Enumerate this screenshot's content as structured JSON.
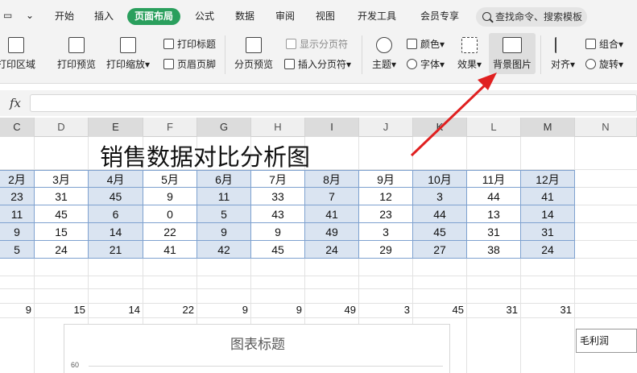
{
  "menu": {
    "tabs": [
      "开始",
      "插入",
      "页面布局",
      "公式",
      "数据",
      "审阅",
      "视图",
      "开发工具",
      "会员专享"
    ],
    "active": "页面布局",
    "search_text": "查找命令、搜索模板"
  },
  "ribbon": {
    "print_area": "打印区域",
    "print_preview": "打印预览",
    "print_scale": "打印缩放",
    "print_titles": "打印标题",
    "header_footer": "页眉页脚",
    "page_break_preview": "分页预览",
    "show_page_break": "显示分页符",
    "insert_page_break": "插入分页符",
    "theme": "主题",
    "color": "颜色",
    "font": "字体",
    "effects": "效果",
    "background_image": "背景图片",
    "align": "对齐",
    "group": "组合",
    "rotate": "旋转"
  },
  "formula_bar": {
    "fx": "fx"
  },
  "columns": [
    "C",
    "D",
    "E",
    "F",
    "G",
    "H",
    "I",
    "J",
    "K",
    "L",
    "M",
    "N"
  ],
  "sheet": {
    "title": "销售数据对比分析图",
    "months": [
      "2月",
      "3月",
      "4月",
      "5月",
      "6月",
      "7月",
      "8月",
      "9月",
      "10月",
      "11月",
      "12月"
    ],
    "rows": [
      [
        "23",
        "31",
        "45",
        "9",
        "11",
        "33",
        "7",
        "12",
        "3",
        "44",
        "41"
      ],
      [
        "11",
        "45",
        "6",
        "0",
        "5",
        "43",
        "41",
        "23",
        "44",
        "13",
        "14"
      ],
      [
        "9",
        "15",
        "14",
        "22",
        "9",
        "9",
        "49",
        "3",
        "45",
        "31",
        "31"
      ],
      [
        "5",
        "24",
        "21",
        "41",
        "42",
        "45",
        "24",
        "29",
        "27",
        "38",
        "24"
      ]
    ],
    "extra_row": [
      "9",
      "15",
      "14",
      "22",
      "9",
      "9",
      "49",
      "3",
      "45",
      "31",
      "31"
    ],
    "legend_label": "毛利润"
  },
  "chart": {
    "title": "图表标题",
    "ytick": "60"
  },
  "colors": {
    "accent": "#2a9f5d",
    "annotation": "#e02020",
    "table_band": "#dae4f1"
  }
}
